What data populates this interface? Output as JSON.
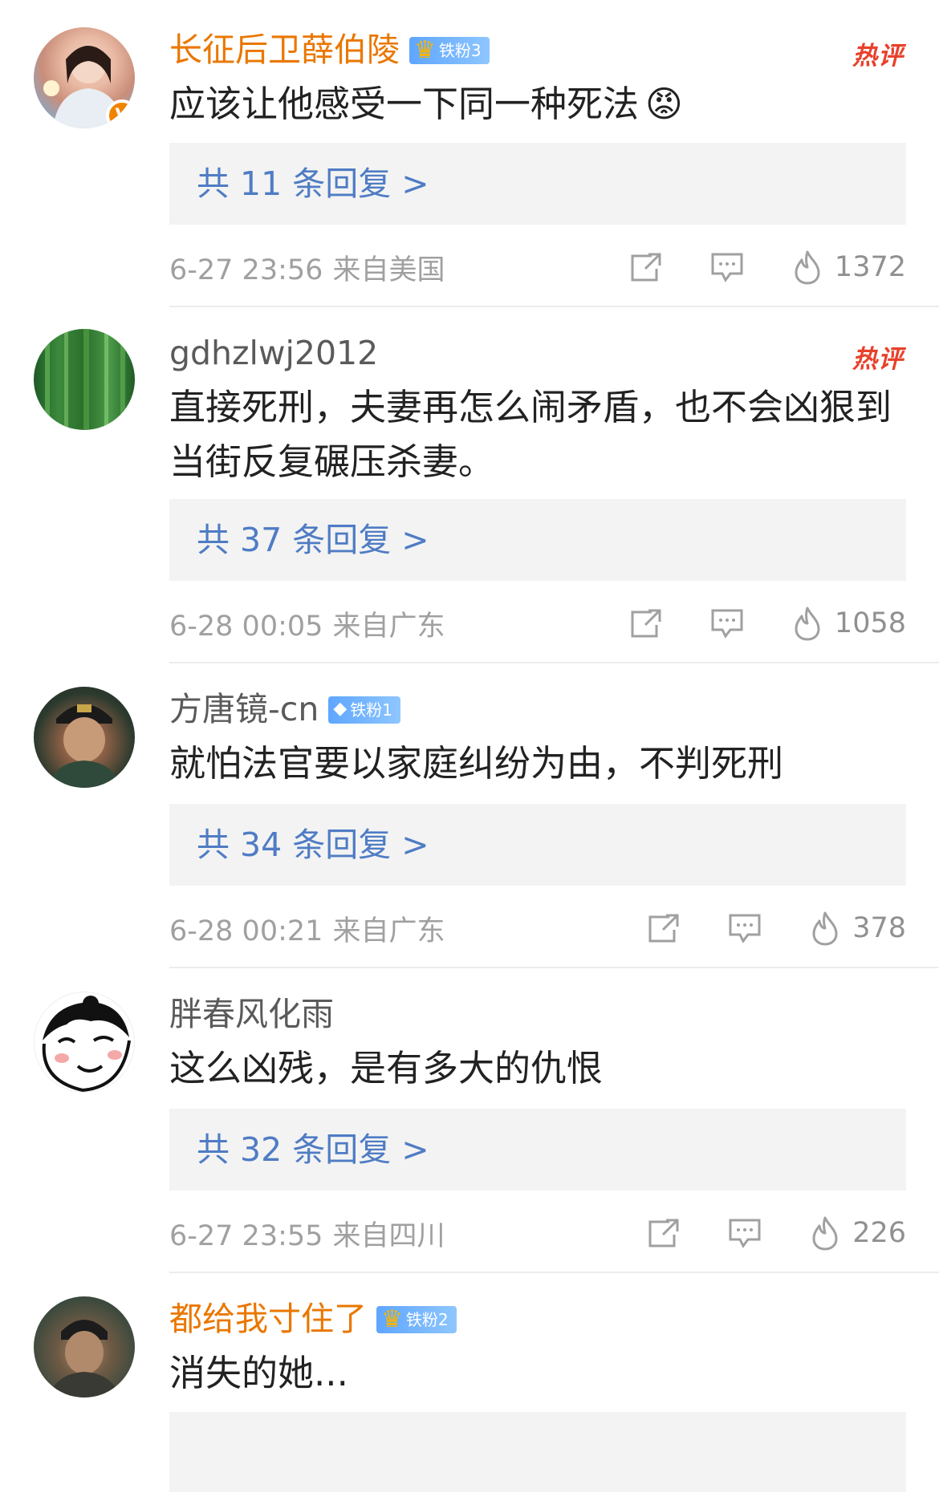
{
  "colors": {
    "username_orange": "#ea7700",
    "reply_blue": "#4f7cc4",
    "hot_red": "#e8412b",
    "fan_badge_blue": "#5fa6ff"
  },
  "comments": [
    {
      "username": "长征后卫薛伯陵",
      "fan_badge": "铁粉3",
      "hot_label": "热评",
      "text": "应该让他感受一下同一种死法",
      "emoji": "😡",
      "replies": "共 11 条回复 >",
      "date": "6-27 23:56",
      "location": "来自美国",
      "likes": "1372",
      "avatar_badge": "V"
    },
    {
      "username": "gdhzlwj2012",
      "hot_label": "热评",
      "text": "直接死刑，夫妻再怎么闹矛盾，也不会凶狠到当街反复碾压杀妻。",
      "replies": "共 37 条回复 >",
      "date": "6-28 00:05",
      "location": "来自广东",
      "likes": "1058"
    },
    {
      "username": "方唐镜-cn",
      "fan_badge": "铁粉1",
      "text": "就怕法官要以家庭纠纷为由，不判死刑",
      "replies": "共 34 条回复 >",
      "date": "6-28 00:21",
      "location": "来自广东",
      "likes": "378"
    },
    {
      "username": "胖春风化雨",
      "text": "这么凶残，是有多大的仇恨",
      "replies": "共 32 条回复 >",
      "date": "6-27 23:55",
      "location": "来自四川",
      "likes": "226"
    },
    {
      "username": "都给我寸住了",
      "fan_badge": "铁粉2",
      "text": "消失的她..."
    }
  ]
}
